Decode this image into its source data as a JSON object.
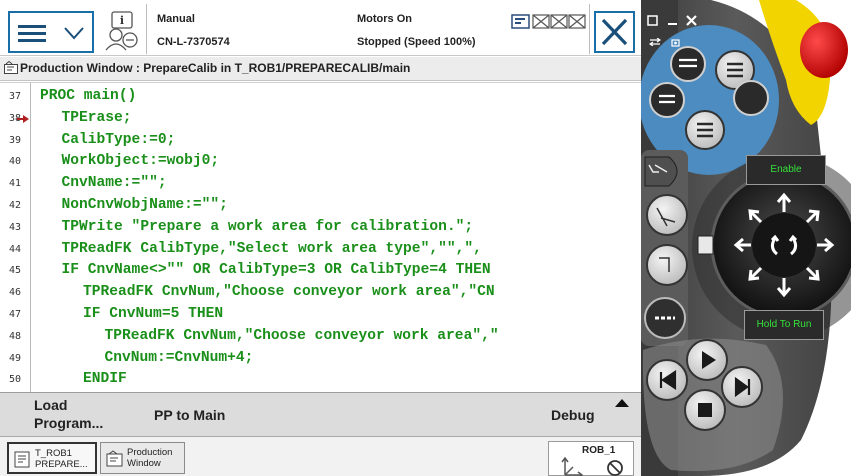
{
  "header": {
    "mode": "Manual",
    "controller": "CN-L-7370574",
    "motors_status": "Motors On",
    "run_status": "Stopped (Speed 100%)"
  },
  "window_title": "Production Window : PrepareCalib in T_ROB1/PREPARECALIB/main",
  "code_lines": [
    {
      "num": "37",
      "indent": 1,
      "text": "PROC main()"
    },
    {
      "num": "38",
      "indent": 2,
      "text": "TPErase;"
    },
    {
      "num": "39",
      "indent": 2,
      "text": "CalibType:=0;"
    },
    {
      "num": "40",
      "indent": 2,
      "text": "WorkObject:=wobj0;"
    },
    {
      "num": "41",
      "indent": 2,
      "text": "CnvName:=\"\";"
    },
    {
      "num": "42",
      "indent": 2,
      "text": "NonCnvWobjName:=\"\";"
    },
    {
      "num": "43",
      "indent": 2,
      "text": "TPWrite \"Prepare a work area for calibration.\";"
    },
    {
      "num": "44",
      "indent": 2,
      "text": "TPReadFK CalibType,\"Select work area type\",\"\",\","
    },
    {
      "num": "45",
      "indent": 2,
      "text": "IF CnvName<>\"\" OR CalibType=3 OR CalibType=4 THEN"
    },
    {
      "num": "46",
      "indent": 3,
      "text": "TPReadFK CnvNum,\"Choose conveyor work area\",\"CN"
    },
    {
      "num": "47",
      "indent": 3,
      "text": "IF CnvNum=5 THEN"
    },
    {
      "num": "48",
      "indent": 4,
      "text": "TPReadFK CnvNum,\"Choose conveyor work area\",\""
    },
    {
      "num": "49",
      "indent": 4,
      "text": "CnvNum:=CnvNum+4;"
    },
    {
      "num": "50",
      "indent": 3,
      "text": "ENDIF"
    }
  ],
  "bottom_menu": {
    "load_program_line1": "Load",
    "load_program_line2": "Program...",
    "pp_to_main": "PP to Main",
    "debug": "Debug"
  },
  "taskbar": {
    "task1_line1": "T_ROB1",
    "task1_line2": "PREPARE...",
    "task2_line1": "Production",
    "task2_line2": "Window",
    "robot": "ROB_1"
  },
  "pendant": {
    "enable": "Enable",
    "hold_to_run": "Hold To Run"
  },
  "colors": {
    "code_green": "#1a8f1a",
    "accent_blue": "#1a6ea8",
    "pendant_body": "#4a4a4a",
    "emergency_red": "#d81e1e",
    "emergency_yellow": "#f2d400",
    "enable_text": "#35e23a"
  }
}
